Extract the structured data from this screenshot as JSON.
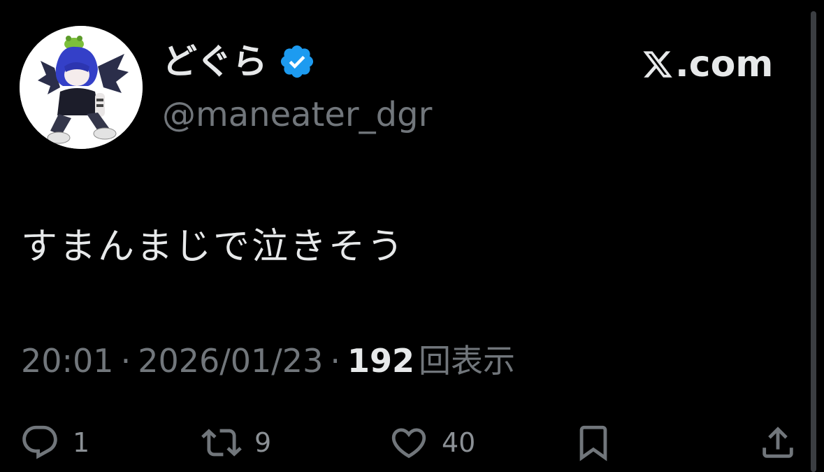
{
  "author": {
    "display_name": "どぐら",
    "handle": "@maneater_dgr",
    "verified_icon": "verified-badge-icon",
    "avatar_icon": "avatar-illustration"
  },
  "brand": {
    "logo_icon": "x-logo-icon",
    "text": ".com"
  },
  "tweet": {
    "text": "すまんまじで泣きそう"
  },
  "meta": {
    "time": "20:01",
    "separator": "·",
    "date": "2026/01/23",
    "views_count": "192",
    "views_label": "回表示"
  },
  "actions": {
    "reply": {
      "icon": "reply-icon",
      "count": "1"
    },
    "repost": {
      "icon": "repost-icon",
      "count": "9"
    },
    "like": {
      "icon": "like-icon",
      "count": "40"
    },
    "bookmark": {
      "icon": "bookmark-icon"
    },
    "share": {
      "icon": "share-icon"
    }
  },
  "colors": {
    "background": "#000000",
    "primary_text": "#e7e9ea",
    "secondary_text": "#71767b",
    "verified_blue": "#1d9bf0"
  }
}
